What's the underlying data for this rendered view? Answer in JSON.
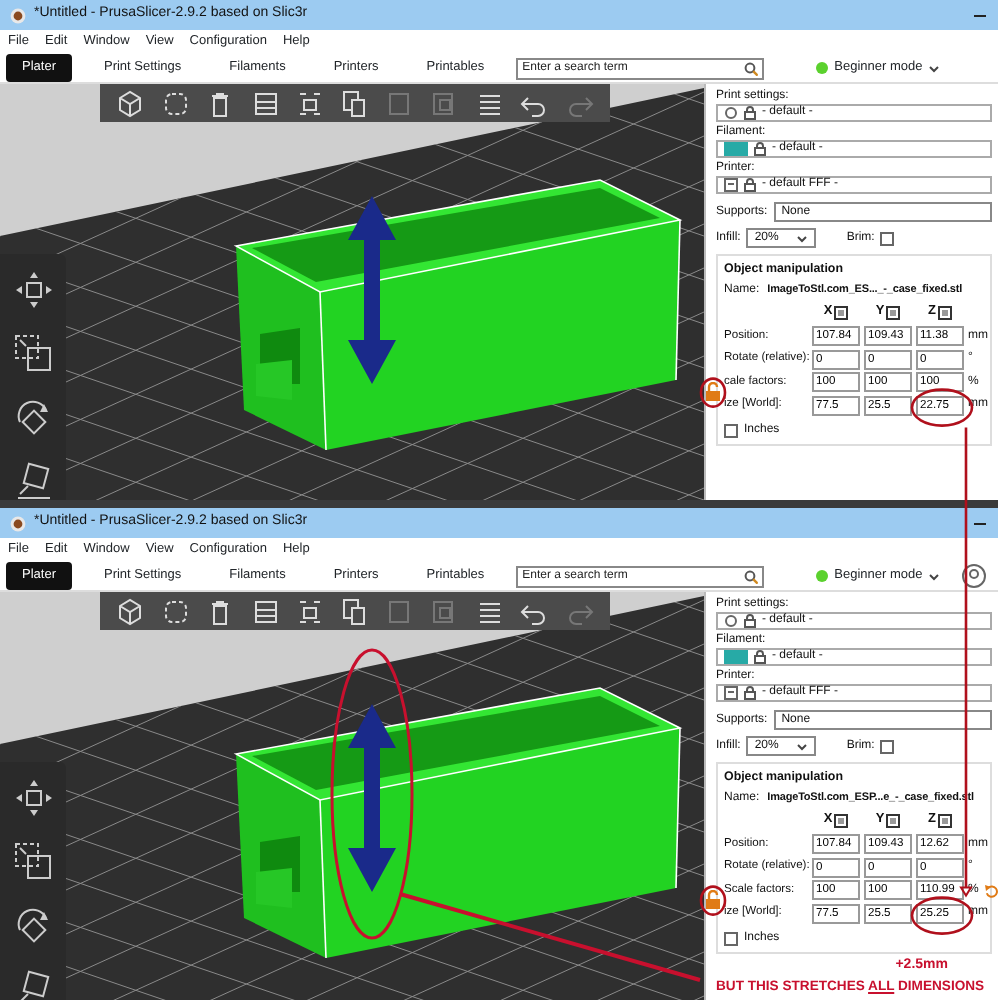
{
  "windows": [
    {
      "title": "*Untitled - PrusaSlicer-2.9.2 based on Slic3r",
      "menu": [
        "File",
        "Edit",
        "Window",
        "View",
        "Configuration",
        "Help"
      ],
      "tabs": [
        {
          "label": "Plater",
          "selected": true
        },
        {
          "label": "Print Settings",
          "selected": false
        },
        {
          "label": "Filaments",
          "selected": false
        },
        {
          "label": "Printers",
          "selected": false
        },
        {
          "label": "Printables",
          "selected": false
        }
      ],
      "search": {
        "placeholder": "Enter a search term"
      },
      "mode": {
        "label": "Beginner mode"
      },
      "presets": [
        {
          "kind": "print",
          "label": "Print settings:",
          "value": "- default -"
        },
        {
          "kind": "filament",
          "label": "Filament:",
          "value": "- default -"
        },
        {
          "kind": "printer",
          "label": "Printer:",
          "value": "- default FFF -"
        }
      ],
      "supports": {
        "label": "Supports:",
        "value": "None"
      },
      "infill": {
        "label": "Infill:",
        "value": "20%"
      },
      "brim": {
        "label": "Brim:",
        "checked": false
      },
      "object_manipulation": {
        "title": "Object manipulation",
        "name_label": "Name:",
        "name_value": "ImageToStl.com_ES..._-_case_fixed.stl",
        "axes": [
          "X",
          "Y",
          "Z"
        ],
        "rows": [
          {
            "label": "Position:",
            "values": [
              "107.84",
              "109.43",
              "11.38"
            ],
            "unit": "mm"
          },
          {
            "label": "Rotate (relative):",
            "values": [
              "0",
              "0",
              "0"
            ],
            "unit": "°"
          },
          {
            "label": "cale factors:",
            "values": [
              "100",
              "100",
              "100"
            ],
            "unit": "%"
          },
          {
            "label": "ize [World]:",
            "values": [
              "77.5",
              "25.5",
              "22.75"
            ],
            "unit": "mm"
          }
        ],
        "inches": {
          "label": "Inches",
          "checked": false
        }
      }
    },
    {
      "title": "*Untitled - PrusaSlicer-2.9.2 based on Slic3r",
      "menu": [
        "File",
        "Edit",
        "Window",
        "View",
        "Configuration",
        "Help"
      ],
      "tabs": [
        {
          "label": "Plater",
          "selected": true
        },
        {
          "label": "Print Settings",
          "selected": false
        },
        {
          "label": "Filaments",
          "selected": false
        },
        {
          "label": "Printers",
          "selected": false
        },
        {
          "label": "Printables",
          "selected": false
        }
      ],
      "search": {
        "placeholder": "Enter a search term"
      },
      "mode": {
        "label": "Beginner mode",
        "account_icon": true
      },
      "presets": [
        {
          "kind": "print",
          "label": "Print settings:",
          "value": "- default -"
        },
        {
          "kind": "filament",
          "label": "Filament:",
          "value": "- default -"
        },
        {
          "kind": "printer",
          "label": "Printer:",
          "value": "- default FFF -"
        }
      ],
      "supports": {
        "label": "Supports:",
        "value": "None"
      },
      "infill": {
        "label": "Infill:",
        "value": "20%"
      },
      "brim": {
        "label": "Brim:",
        "checked": false
      },
      "object_manipulation": {
        "title": "Object manipulation",
        "name_label": "Name:",
        "name_value": "ImageToStl.com_ESP...e_-_case_fixed.stl",
        "axes": [
          "X",
          "Y",
          "Z"
        ],
        "rows": [
          {
            "label": "Position:",
            "values": [
              "107.84",
              "109.43",
              "12.62"
            ],
            "unit": "mm"
          },
          {
            "label": "Rotate (relative):",
            "values": [
              "0",
              "0",
              "0"
            ],
            "unit": "°"
          },
          {
            "label": "Scale factors:",
            "values": [
              "100",
              "100",
              "110.99"
            ],
            "unit": "%",
            "reset": true
          },
          {
            "label": "ize [World]:",
            "values": [
              "77.5",
              "25.5",
              "25.25"
            ],
            "unit": "mm"
          }
        ],
        "inches": {
          "label": "Inches",
          "checked": false
        }
      },
      "annotations": {
        "delta": "+2.5mm",
        "note": {
          "before": "BUT THIS STRETCHES ",
          "underlined": "ALL",
          "after": " DIMENSIONS"
        }
      }
    }
  ]
}
